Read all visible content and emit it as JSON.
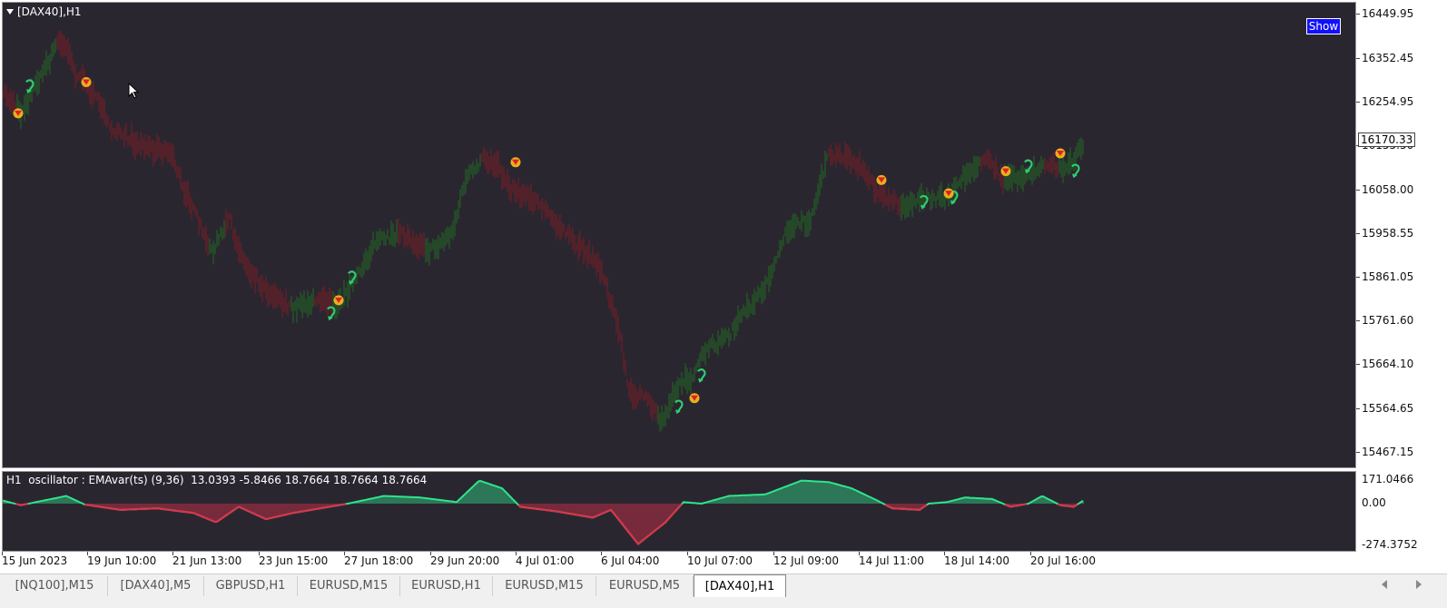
{
  "chart": {
    "title": "[DAX40],H1",
    "show_button": "Show",
    "current_price": "16170.33",
    "colors": {
      "background": "#2a2630",
      "up": "#1f6b1f",
      "down": "#7a1c24",
      "osc_up": "#2ee58c",
      "osc_down": "#e0304a"
    },
    "price_axis": [
      "16449.95",
      "16352.45",
      "16254.95",
      "16155.50",
      "16058.00",
      "15958.55",
      "15861.05",
      "15761.60",
      "15664.10",
      "15564.65",
      "15467.15"
    ],
    "osc_axis": [
      "171.0466",
      "0.00",
      "-274.3752"
    ],
    "time_axis": [
      "15 Jun 2023",
      "19 Jun 10:00",
      "21 Jun 13:00",
      "23 Jun 15:00",
      "27 Jun 18:00",
      "29 Jun 20:00",
      "4 Jul 01:00",
      "6 Jul 04:00",
      "10 Jul 07:00",
      "12 Jul 09:00",
      "14 Jul 11:00",
      "18 Jul 14:00",
      "20 Jul 16:00"
    ],
    "oscillator_label": "H1  oscillator : EMAvar(ts) (9,36)  13.0393 -5.8466 18.7664 18.7664 18.7664"
  },
  "chart_data": {
    "type": "line",
    "title": "[DAX40],H1",
    "price_range": [
      15467.15,
      16449.95
    ],
    "price_points": [
      [
        0,
        16280
      ],
      [
        20,
        16230
      ],
      [
        35,
        16290
      ],
      [
        50,
        16340
      ],
      [
        60,
        16390
      ],
      [
        70,
        16380
      ],
      [
        80,
        16320
      ],
      [
        95,
        16290
      ],
      [
        120,
        16200
      ],
      [
        150,
        16160
      ],
      [
        185,
        16140
      ],
      [
        200,
        16060
      ],
      [
        230,
        15920
      ],
      [
        250,
        15990
      ],
      [
        265,
        15900
      ],
      [
        290,
        15830
      ],
      [
        320,
        15790
      ],
      [
        345,
        15810
      ],
      [
        370,
        15800
      ],
      [
        390,
        15860
      ],
      [
        410,
        15940
      ],
      [
        440,
        15960
      ],
      [
        470,
        15920
      ],
      [
        495,
        15960
      ],
      [
        510,
        16080
      ],
      [
        530,
        16130
      ],
      [
        545,
        16110
      ],
      [
        560,
        16060
      ],
      [
        590,
        16030
      ],
      [
        630,
        15940
      ],
      [
        660,
        15880
      ],
      [
        680,
        15730
      ],
      [
        690,
        15600
      ],
      [
        710,
        15590
      ],
      [
        725,
        15540
      ],
      [
        745,
        15620
      ],
      [
        760,
        15640
      ],
      [
        775,
        15700
      ],
      [
        800,
        15730
      ],
      [
        820,
        15790
      ],
      [
        840,
        15840
      ],
      [
        865,
        15970
      ],
      [
        890,
        15990
      ],
      [
        910,
        16140
      ],
      [
        940,
        16120
      ],
      [
        965,
        16050
      ],
      [
        995,
        16020
      ],
      [
        1010,
        16040
      ],
      [
        1040,
        16040
      ],
      [
        1060,
        16090
      ],
      [
        1080,
        16130
      ],
      [
        1105,
        16080
      ],
      [
        1130,
        16090
      ],
      [
        1150,
        16120
      ],
      [
        1170,
        16100
      ],
      [
        1190,
        16160
      ]
    ],
    "oscillator_range": [
      -274.3752,
      171.0466
    ],
    "oscillator_points": [
      [
        0,
        20
      ],
      [
        20,
        -10
      ],
      [
        45,
        20
      ],
      [
        70,
        50
      ],
      [
        90,
        -5
      ],
      [
        130,
        -40
      ],
      [
        170,
        -30
      ],
      [
        210,
        -60
      ],
      [
        235,
        -120
      ],
      [
        260,
        -20
      ],
      [
        290,
        -100
      ],
      [
        320,
        -60
      ],
      [
        350,
        -30
      ],
      [
        380,
        0
      ],
      [
        420,
        50
      ],
      [
        460,
        40
      ],
      [
        500,
        10
      ],
      [
        525,
        150
      ],
      [
        550,
        100
      ],
      [
        570,
        -20
      ],
      [
        610,
        -50
      ],
      [
        650,
        -90
      ],
      [
        670,
        -40
      ],
      [
        700,
        -260
      ],
      [
        730,
        -120
      ],
      [
        750,
        10
      ],
      [
        770,
        0
      ],
      [
        800,
        50
      ],
      [
        840,
        60
      ],
      [
        880,
        150
      ],
      [
        910,
        140
      ],
      [
        935,
        100
      ],
      [
        960,
        30
      ],
      [
        980,
        -30
      ],
      [
        1010,
        -40
      ],
      [
        1020,
        0
      ],
      [
        1040,
        10
      ],
      [
        1060,
        40
      ],
      [
        1090,
        30
      ],
      [
        1110,
        -20
      ],
      [
        1130,
        0
      ],
      [
        1145,
        50
      ],
      [
        1165,
        -10
      ],
      [
        1180,
        -20
      ],
      [
        1190,
        18.7664
      ]
    ],
    "buy_markers": [
      [
        30,
        16290
      ],
      [
        385,
        15860
      ],
      [
        362,
        15780
      ],
      [
        745,
        15570
      ],
      [
        770,
        15640
      ],
      [
        1015,
        16030
      ],
      [
        1048,
        16040
      ],
      [
        1130,
        16110
      ],
      [
        1182,
        16100
      ]
    ],
    "sell_markers": [
      [
        17,
        16230
      ],
      [
        92,
        16300
      ],
      [
        370,
        15810
      ],
      [
        565,
        16120
      ],
      [
        762,
        15590
      ],
      [
        968,
        16080
      ],
      [
        1042,
        16050
      ],
      [
        1105,
        16100
      ],
      [
        1165,
        16140
      ]
    ]
  }
}
